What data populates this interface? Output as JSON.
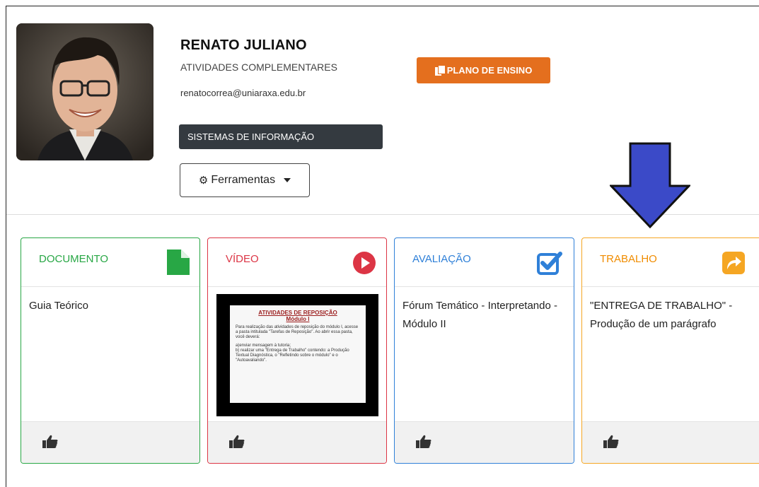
{
  "profile": {
    "name": "RENATO JULIANO",
    "subtitle": "ATIVIDADES COMPLEMENTARES",
    "email": "renatocorrea@uniaraxa.edu.br",
    "course": "SISTEMAS DE INFORMAÇÃO",
    "tools_label": "Ferramentas",
    "plano_label": "PLANO DE ENSINO"
  },
  "colors": {
    "documento": "#28a745",
    "video": "#dc3545",
    "avaliacao": "#2f80d8",
    "trabalho": "#f5a623",
    "plano": "#e46f1e",
    "arrow": "#3b4ac8"
  },
  "cards": [
    {
      "type": "DOCUMENTO",
      "icon": "file-icon",
      "content": "Guia Teórico"
    },
    {
      "type": "VÍDEO",
      "icon": "play-icon",
      "thumbnail": {
        "title_line1": "ATIVIDADES DE REPOSIÇÃO",
        "title_line2": "Módulo I",
        "bullet": "Para realização das atividades de reposição do módulo I, acesse a pasta intitulada \"Tarefas de Reposição\". Ao abrir essa pasta, você deverá:",
        "item_a": "a)enviar mensagem à tutoria;",
        "item_b": "b) realizar uma \"Entrega de Trabalho\" contendo: a Produção Textual Diagnóstica, o \"Refletindo sobre o módulo\" e o \"Autoavaliando\"."
      }
    },
    {
      "type": "AVALIAÇÃO",
      "icon": "checkbox-icon",
      "content": "Fórum Temático - Interpretando - Módulo II"
    },
    {
      "type": "TRABALHO",
      "icon": "share-icon",
      "content": "\"ENTREGA DE TRABALHO\" - Produção de um parágrafo"
    }
  ]
}
